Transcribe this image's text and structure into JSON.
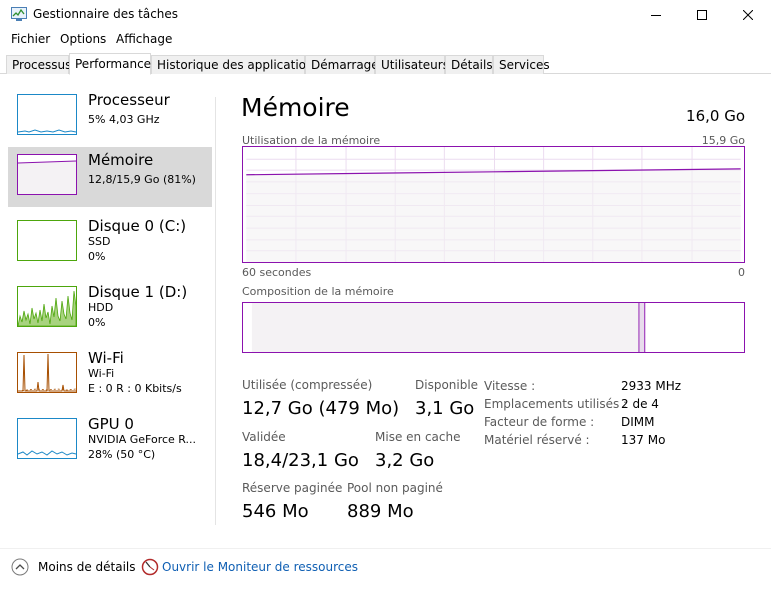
{
  "window": {
    "title": "Gestionnaire des tâches"
  },
  "menu": [
    "Fichier",
    "Options",
    "Affichage"
  ],
  "tabs": [
    "Processus",
    "Performance",
    "Historique des applications",
    "Démarrage",
    "Utilisateurs",
    "Détails",
    "Services"
  ],
  "active_tab": "Performance",
  "sidebar": [
    {
      "title": "Processeur",
      "lines": [
        "5%  4,03 GHz"
      ],
      "color": "#1b88c7"
    },
    {
      "title": "Mémoire",
      "lines": [
        "12,8/15,9 Go (81%)"
      ],
      "color": "#8b12ae"
    },
    {
      "title": "Disque 0 (C:)",
      "lines": [
        "SSD",
        "0%"
      ],
      "color": "#4da60c"
    },
    {
      "title": "Disque 1 (D:)",
      "lines": [
        "HDD",
        "0%"
      ],
      "color": "#4da60c"
    },
    {
      "title": "Wi-Fi",
      "lines": [
        "Wi-Fi",
        "E : 0  R : 0 Kbits/s"
      ],
      "color": "#a74f01"
    },
    {
      "title": "GPU 0",
      "lines": [
        "NVIDIA GeForce R...",
        "28%  (50 °C)"
      ],
      "color": "#1b88c7"
    }
  ],
  "main": {
    "title": "Mémoire",
    "total": "16,0 Go",
    "usage_label": "Utilisation de la mémoire",
    "usage_max": "15,9 Go",
    "time_left": "60 secondes",
    "time_right": "0",
    "usage_fraction": 0.81,
    "composition_label": "Composition de la mémoire",
    "composition_in_use_fraction": 0.8,
    "composition_modified_fraction": 0.01,
    "stats": [
      {
        "label": "Utilisée (compressée)",
        "value": "12,7 Go (479 Mo)"
      },
      {
        "label": "Disponible",
        "value": "3,1 Go"
      },
      {
        "label": "Validée",
        "value": "18,4/23,1 Go"
      },
      {
        "label": "Mise en cache",
        "value": "3,2 Go"
      },
      {
        "label": "Réserve paginée",
        "value": "546 Mo"
      },
      {
        "label": "Pool non paginé",
        "value": "889 Mo"
      }
    ],
    "specs": [
      {
        "label": "Vitesse :",
        "value": "2933 MHz"
      },
      {
        "label": "Emplacements utilisés :",
        "value": "2 de 4"
      },
      {
        "label": "Facteur de forme :",
        "value": "DIMM"
      },
      {
        "label": "Matériel réservé :",
        "value": "137 Mo"
      }
    ]
  },
  "footer": {
    "less_details": "Moins de détails",
    "open_monitor": "Ouvrir le Moniteur de ressources"
  },
  "colors": {
    "memory": "#8b12ae",
    "memory_fill": "#f4f2f4",
    "grid": "#ecdcf0",
    "link": "#0f5fb3"
  }
}
